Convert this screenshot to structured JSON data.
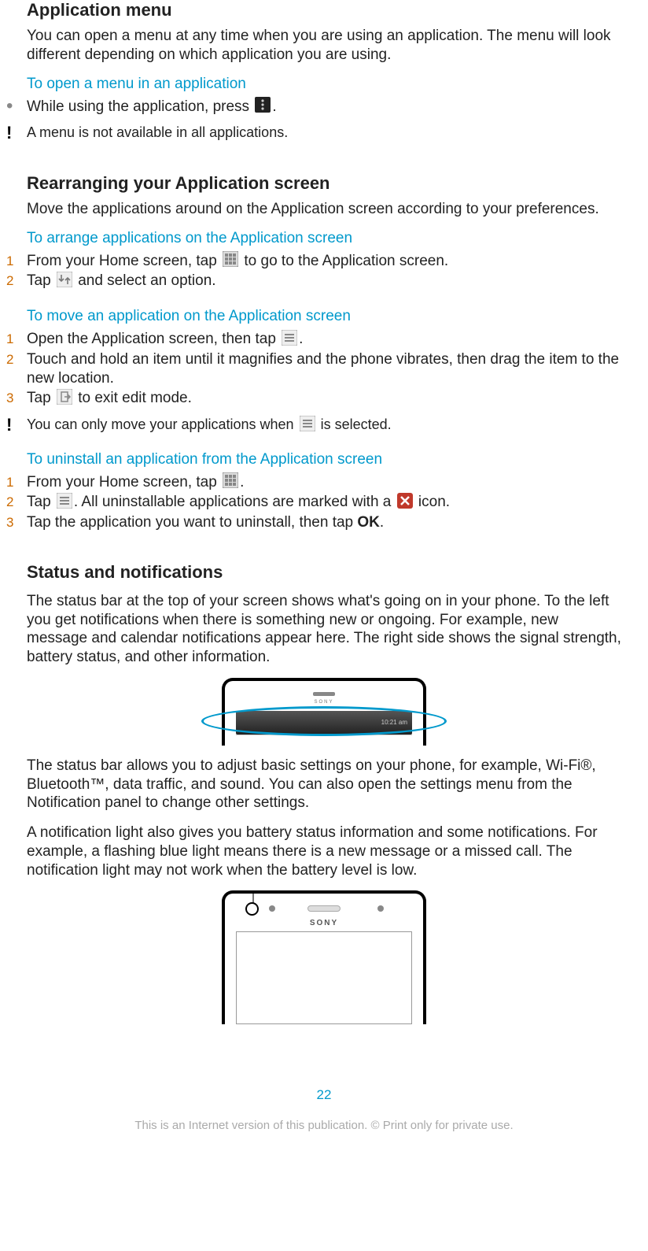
{
  "s1": {
    "title": "Application menu",
    "intro": "You can open a menu at any time when you are using an application. The menu will look different depending on which application you are using.",
    "sub1": "To open a menu in an application",
    "step1a": "While using the application, press ",
    "step1b": ".",
    "note": "A menu is not available in all applications."
  },
  "s2": {
    "title": "Rearranging your Application screen",
    "intro": "Move the applications around on the Application screen according to your preferences.",
    "sub1": "To arrange applications on the Application screen",
    "a1a": "From your Home screen, tap ",
    "a1b": " to go to the Application screen.",
    "a2a": "Tap ",
    "a2b": " and select an option.",
    "sub2": "To move an application on the Application screen",
    "b1a": "Open the Application screen, then tap ",
    "b1b": ".",
    "b2": "Touch and hold an item until it magnifies and the phone vibrates, then drag the item to the new location.",
    "b3a": "Tap ",
    "b3b": " to exit edit mode.",
    "note2a": "You can only move your applications when ",
    "note2b": " is selected.",
    "sub3": "To uninstall an application from the Application screen",
    "c1a": "From your Home screen, tap ",
    "c1b": ".",
    "c2a": "Tap ",
    "c2b": ". All uninstallable applications are marked with a ",
    "c2c": " icon.",
    "c3a": "Tap the application you want to uninstall, then tap ",
    "c3ok": "OK",
    "c3b": "."
  },
  "s3": {
    "title": "Status and notifications",
    "p1": "The status bar at the top of your screen shows what's going on in your phone. To the left you get notifications when there is something new or ongoing. For example, new message and calendar notifications appear here. The right side shows the signal strength, battery status, and other information.",
    "p2": "The status bar allows you to adjust basic settings on your phone, for example, Wi-Fi®, Bluetooth™, data traffic, and sound. You can also open the settings menu from the Notification panel to change other settings.",
    "p3": "A notification light also gives you battery status information and some notifications. For example, a flashing blue light means there is a new message or a missed call. The notification light may not work when the battery level is low.",
    "brand": "SONY",
    "time": "10:21 am"
  },
  "footer": {
    "page": "22",
    "disclaimer": "This is an Internet version of this publication. © Print only for private use."
  },
  "nums": {
    "n1": "1",
    "n2": "2",
    "n3": "3"
  },
  "glyphs": {
    "bullet": "•",
    "bang": "!"
  }
}
